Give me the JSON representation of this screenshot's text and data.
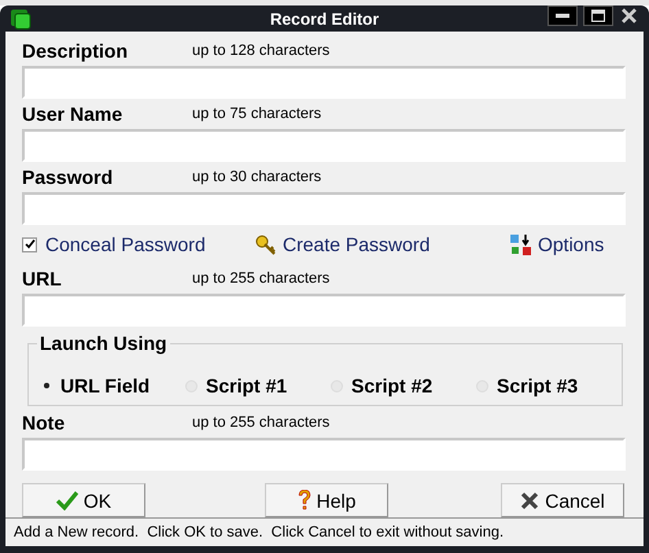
{
  "window": {
    "title": "Record Editor"
  },
  "fields": [
    {
      "label": "Description",
      "hint": "up to 128 characters"
    },
    {
      "label": "User Name",
      "hint": "up to 75 characters"
    },
    {
      "label": "Password",
      "hint": "up to 30 characters"
    }
  ],
  "conceal_password": {
    "label": "Conceal Password",
    "checked": true
  },
  "create_password": {
    "label": "Create Password"
  },
  "options": {
    "label": "Options"
  },
  "url": {
    "label": "URL",
    "hint": "up to 255 characters"
  },
  "launch_using": {
    "title": "Launch Using",
    "options": [
      {
        "label": "URL Field",
        "selected": true
      },
      {
        "label": "Script #1",
        "selected": false
      },
      {
        "label": "Script #2",
        "selected": false
      },
      {
        "label": "Script #3",
        "selected": false
      }
    ]
  },
  "note": {
    "label": "Note",
    "hint": "up to 255 characters"
  },
  "buttons": [
    {
      "kind": "ok",
      "label": "OK"
    },
    {
      "kind": "help",
      "label": "Help"
    },
    {
      "kind": "cancel",
      "label": "Cancel"
    }
  ],
  "status_bar": "Add a New record.  Click OK to save.  Click Cancel to exit without saving."
}
